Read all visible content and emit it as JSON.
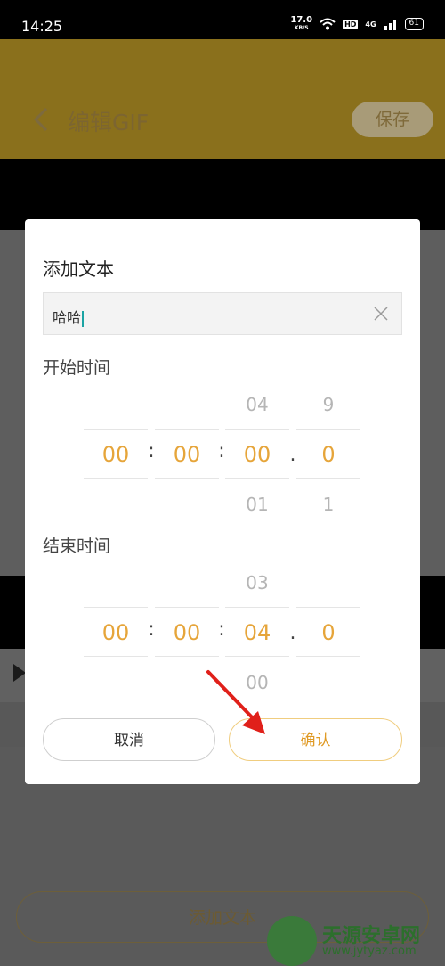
{
  "status_bar": {
    "time": "14:25",
    "net_speed_value": "17.0",
    "net_speed_unit": "KB/S",
    "hd_label": "HD",
    "network_label": "4G",
    "battery_level": "61",
    "icons": [
      "wifi-icon",
      "signal-icon",
      "battery-icon"
    ]
  },
  "header": {
    "title": "编辑GIF",
    "save_label": "保存",
    "accent_color": "#f5c531"
  },
  "dialog": {
    "title": "添加文本",
    "text_value": "哈哈",
    "start_label": "开始时间",
    "end_label": "结束时间",
    "start_picker": {
      "above": [
        "",
        "",
        "04",
        "9"
      ],
      "selected": [
        "00",
        "00",
        "00",
        "0"
      ],
      "below": [
        "",
        "",
        "01",
        "1"
      ],
      "separators": [
        ":",
        ":",
        "."
      ]
    },
    "end_picker": {
      "above": [
        "",
        "",
        "03",
        ""
      ],
      "selected": [
        "00",
        "00",
        "04",
        "0"
      ],
      "below": [
        "",
        "",
        "00",
        ""
      ],
      "separators": [
        ":",
        ":",
        "."
      ]
    },
    "cancel_label": "取消",
    "confirm_label": "确认",
    "selected_color": "#e6a53a"
  },
  "bottom": {
    "add_text_label": "添加文本"
  },
  "watermark": {
    "name": "天源安卓网",
    "url": "www.jytyaz.com"
  }
}
